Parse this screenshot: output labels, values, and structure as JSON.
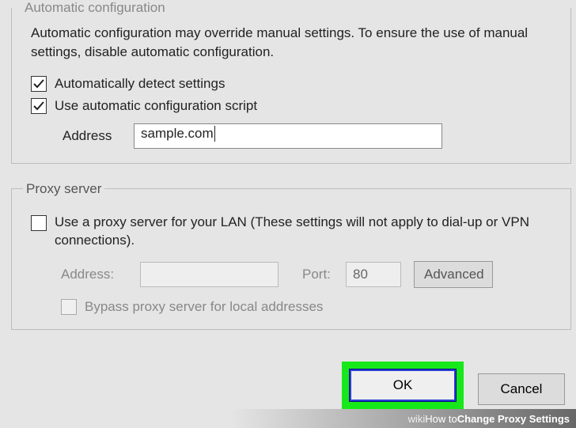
{
  "auto_config": {
    "legend": "Automatic configuration",
    "description": "Automatic configuration may override manual settings.  To ensure the use of manual settings, disable automatic configuration.",
    "detect_label": "Automatically detect settings",
    "detect_checked": true,
    "script_label": "Use automatic configuration script",
    "script_checked": true,
    "address_label": "Address",
    "address_value": "sample.com"
  },
  "proxy": {
    "legend": "Proxy server",
    "use_label": "Use a proxy server for your LAN (These settings will not apply to dial-up or VPN connections).",
    "use_checked": false,
    "address_label": "Address:",
    "address_value": "",
    "port_label": "Port:",
    "port_value": "80",
    "advanced_label": "Advanced",
    "bypass_label": "Bypass proxy server for local addresses",
    "bypass_checked": false
  },
  "footer": {
    "ok_label": "OK",
    "cancel_label": "Cancel"
  },
  "caption": {
    "brand": "wiki",
    "how": "How to ",
    "title": "Change Proxy Settings"
  }
}
